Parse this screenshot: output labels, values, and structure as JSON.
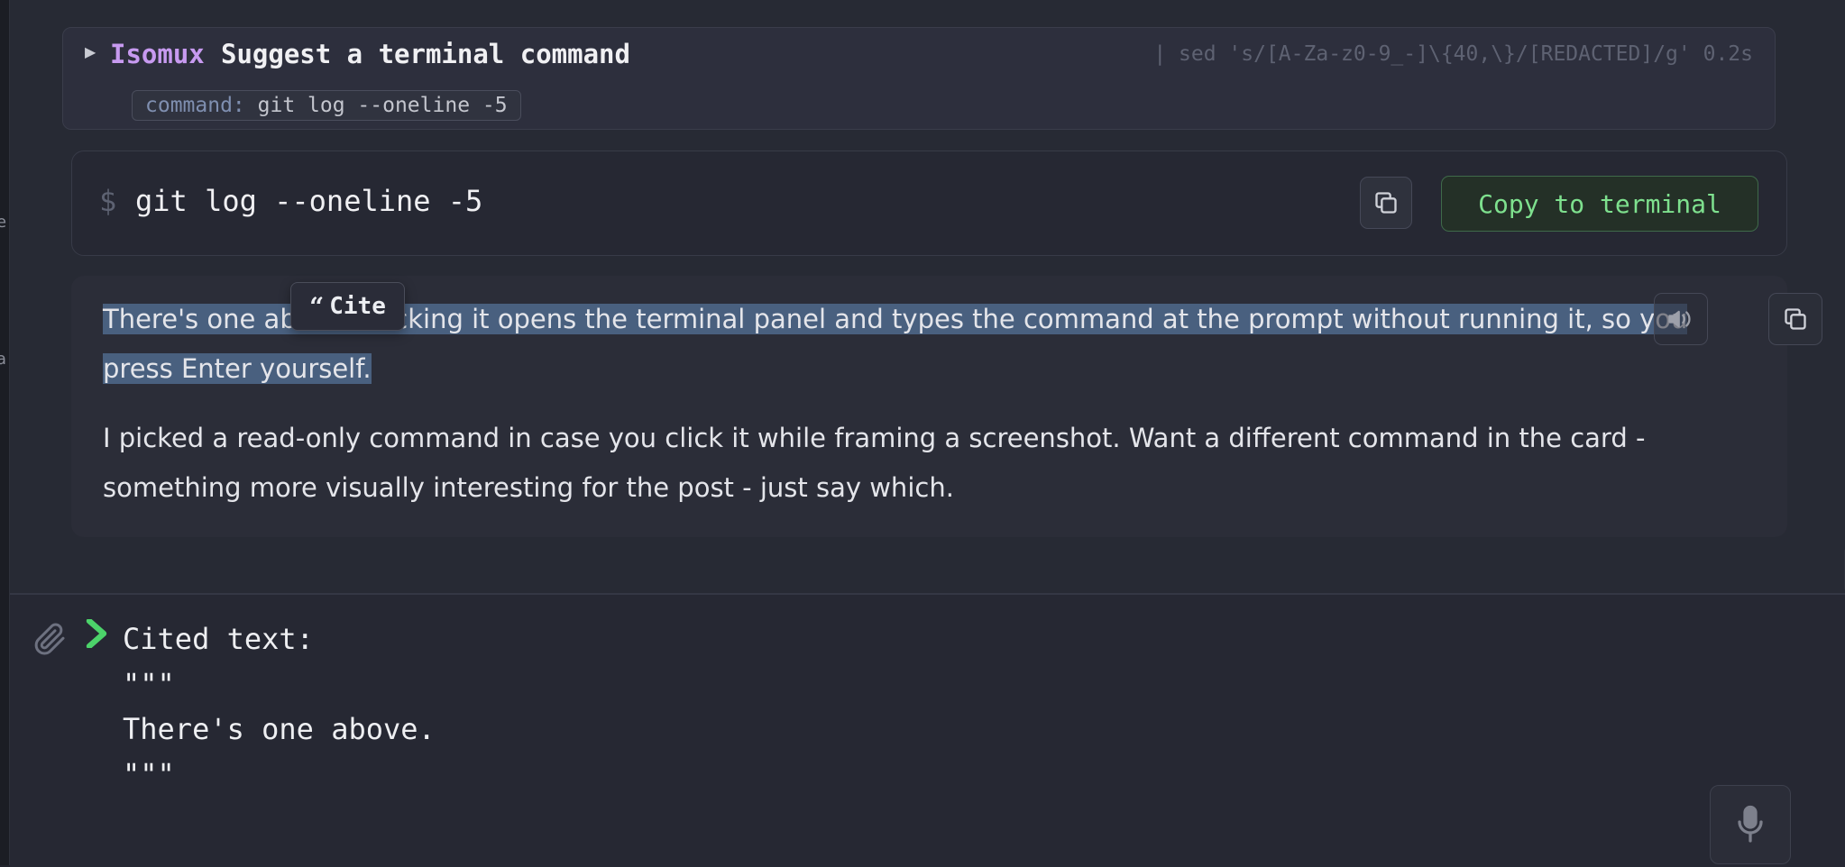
{
  "tool_call": {
    "tool_name": "Isomux",
    "title": "Suggest a terminal command",
    "piped_command": "| sed 's/[A-Za-z0-9_-]\\{40,\\}/[REDACTED]/g' 0.2s",
    "arg_key": "command:",
    "arg_value": "git log --oneline -5"
  },
  "command_card": {
    "prompt_symbol": "$",
    "command": "git log --oneline -5",
    "copy_to_terminal_label": "Copy to terminal"
  },
  "message": {
    "paragraph1_selected": "There's one above. Clicking it opens the terminal panel and types the command at the prompt without running it, so you press Enter yourself.",
    "paragraph2": "I picked a read-only command in case you click it while framing a screenshot. Want a different command in the card - something more visually interesting for the post - just say which.",
    "cite_label": "Cite"
  },
  "input": {
    "text": "Cited text:\n\"\"\"\nThere's one above.\n\"\"\""
  },
  "colors": {
    "tool_name": "#c79af0",
    "copy_to_terminal": "#7ee08e",
    "selection": "#49607f",
    "prompt_chevron": "#4cd36a"
  },
  "icons": [
    "play-triangle-icon",
    "copy-icon",
    "speaker-icon",
    "paperclip-icon",
    "chevron-right-icon",
    "microphone-icon",
    "quote-icon"
  ]
}
